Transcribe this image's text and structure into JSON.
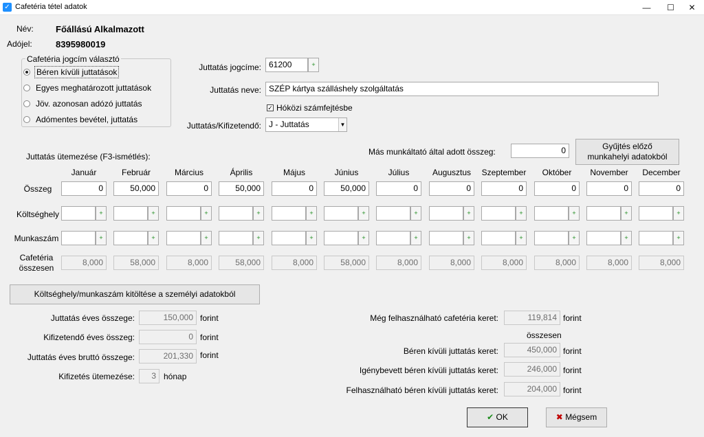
{
  "window": {
    "title": "Cafetéria tétel adatok",
    "controls": {
      "minimize": "—",
      "maximize": "☐",
      "close": "✕"
    }
  },
  "employee": {
    "name_label": "Név:",
    "name_value": "Főállású Alkalmazott",
    "tax_label": "Adójel:",
    "tax_value": "8395980019"
  },
  "selector": {
    "title": "Cafetéria jogcím választó",
    "options": [
      {
        "label": "Béren kívüli juttatások",
        "selected": true
      },
      {
        "label": "Egyes meghatározott juttatások",
        "selected": false
      },
      {
        "label": "Jöv. azonosan adózó juttatás",
        "selected": false
      },
      {
        "label": "Adómentes bevétel, juttatás",
        "selected": false
      }
    ]
  },
  "benefit": {
    "code_label": "Juttatás jogcíme:",
    "code_value": "61200",
    "name_label": "Juttatás neve:",
    "name_value": "SZÉP kártya szálláshely szolgáltatás",
    "hokozi_label": "Hóközi számfejtésbe",
    "hokozi_checked": true,
    "payable_label": "Juttatás/Kifizetendő:",
    "payable_value": "J - Juttatás"
  },
  "schedule": {
    "title": "Juttatás ütemezése (F3-ismétlés):",
    "other_employer_label": "Más munkáltató által adott összeg:",
    "other_employer_value": "0",
    "collect_button": [
      "Gyűjtés előző",
      "munkahelyi adatokból"
    ],
    "row_labels": {
      "amount": "Összeg",
      "cost_center": "Költséghely",
      "job_number": "Munkaszám",
      "total": [
        "Cafetéria",
        "összesen"
      ]
    },
    "months": [
      "Január",
      "Február",
      "Március",
      "Április",
      "Május",
      "Június",
      "Július",
      "Augusztus",
      "Szeptember",
      "Október",
      "November",
      "December"
    ],
    "amounts": [
      "0",
      "50,000",
      "0",
      "50,000",
      "0",
      "50,000",
      "0",
      "0",
      "0",
      "0",
      "0",
      "0"
    ],
    "totals": [
      "8,000",
      "58,000",
      "8,000",
      "58,000",
      "8,000",
      "58,000",
      "8,000",
      "8,000",
      "8,000",
      "8,000",
      "8,000",
      "8,000"
    ],
    "pick_icon": "add-plus-icon",
    "pick_glyph": "+"
  },
  "fill_button": "Költséghely/munkaszám kitöltése a személyi adatokból",
  "summary_left": {
    "annual_label": "Juttatás éves összege:",
    "annual_value": "150,000",
    "payable_label": "Kifizetendő éves összeg:",
    "payable_value": "0",
    "gross_label": "Juttatás éves bruttó összege:",
    "gross_value": "201,330",
    "schedule_label": "Kifizetés ütemezése:",
    "schedule_value": "3",
    "unit": "forint",
    "month_unit": "hónap"
  },
  "summary_right": {
    "remaining_label": "Még felhasználható cafetéria keret:",
    "remaining_value": "119,814",
    "total_header": "összesen",
    "nonwage_label": "Béren kívüli juttatás keret:",
    "nonwage_value": "450,000",
    "used_label": "Igénybevett béren kívüli juttatás keret:",
    "used_value": "246,000",
    "available_label": "Felhasználható béren kívüli juttatás keret:",
    "available_value": "204,000",
    "unit": "forint"
  },
  "buttons": {
    "ok": "OK",
    "ok_icon": "✔",
    "cancel": "Mégsem",
    "cancel_icon": "✖"
  },
  "colors": {
    "ok_icon": "#1a8a1a",
    "cancel_icon": "#c00000",
    "app_icon": "#1e90ff"
  }
}
